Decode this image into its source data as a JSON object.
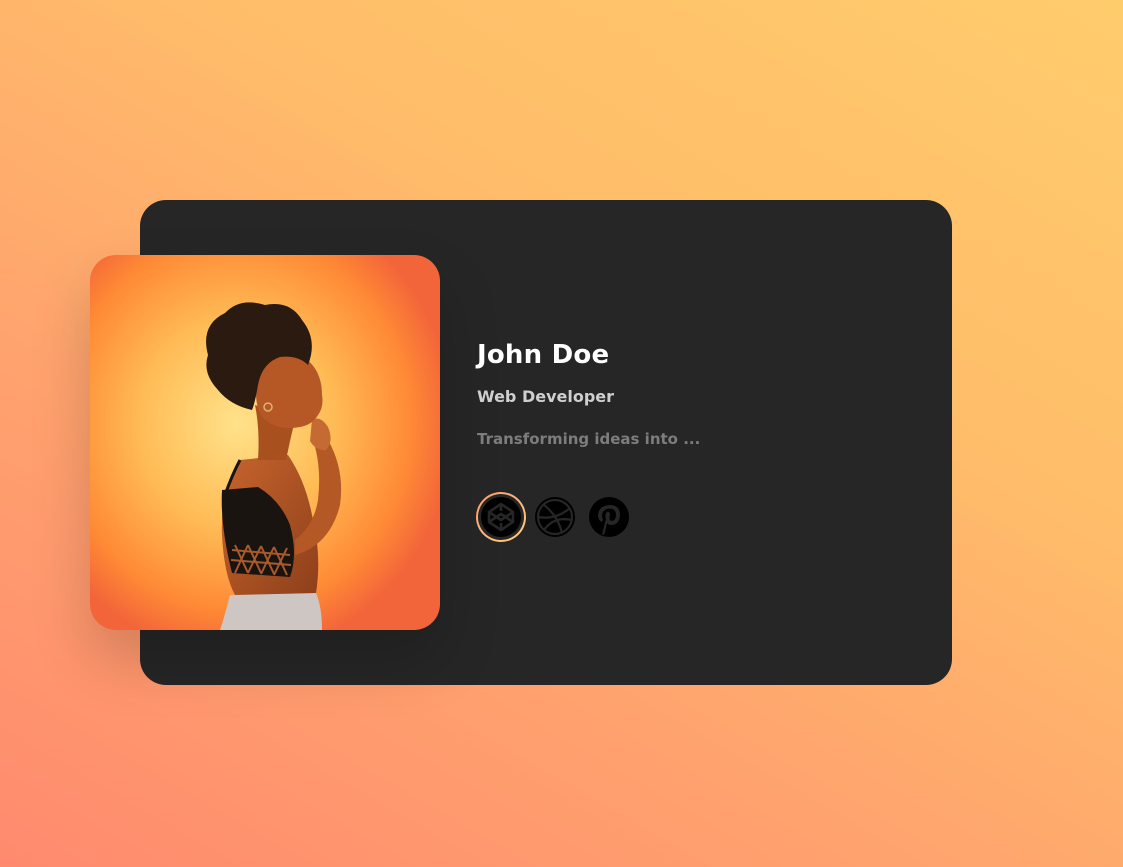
{
  "profile": {
    "name": "John Doe",
    "role": "Web Developer",
    "bio": "Transforming ideas into ...",
    "photo_alt": "profile-photo"
  },
  "socials": [
    {
      "icon": "codepen-icon",
      "active": true
    },
    {
      "icon": "dribbble-icon",
      "active": false
    },
    {
      "icon": "pinterest-icon",
      "active": false
    }
  ],
  "colors": {
    "card": "#262626",
    "name": "#ffffff",
    "role": "#cfcfcf",
    "bio": "#7d7d7d",
    "accent_start": "#ff9a6e",
    "accent_end": "#ffcf80"
  }
}
